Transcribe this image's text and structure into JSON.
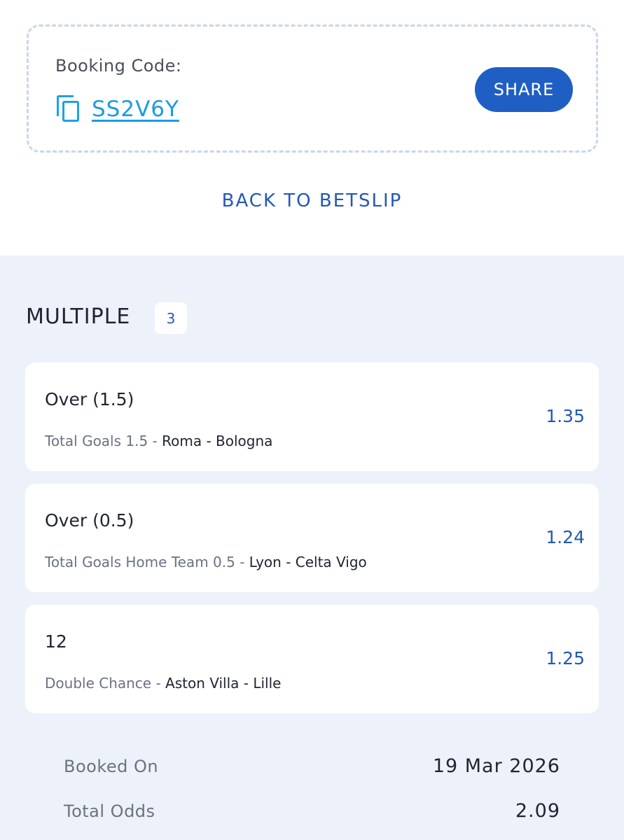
{
  "booking": {
    "label": "Booking Code:",
    "code": "SS2V6Y",
    "share_label": "SHARE"
  },
  "back_label": "BACK TO BETSLIP",
  "betslip": {
    "title": "MULTIPLE",
    "count": "3",
    "selections": [
      {
        "selection": "Over (1.5)",
        "market": "Total Goals 1.5",
        "separator": " - ",
        "match": "Roma - Bologna",
        "odds": "1.35"
      },
      {
        "selection": "Over (0.5)",
        "market": "Total Goals Home Team 0.5",
        "separator": " - ",
        "match": "Lyon - Celta Vigo",
        "odds": "1.24"
      },
      {
        "selection": "12",
        "market": "Double Chance",
        "separator": " - ",
        "match": "Aston Villa - Lille",
        "odds": "1.25"
      }
    ]
  },
  "summary": {
    "booked_on_label": "Booked On",
    "booked_on_value": "19 Mar 2026",
    "total_odds_label": "Total Odds",
    "total_odds_value": "2.09"
  },
  "colors": {
    "accent": "#1f5fc4",
    "link": "#1d9be0",
    "odds": "#2458b6",
    "panel_bg": "#edf2fa"
  },
  "icons": {
    "copy": "copy-icon"
  }
}
